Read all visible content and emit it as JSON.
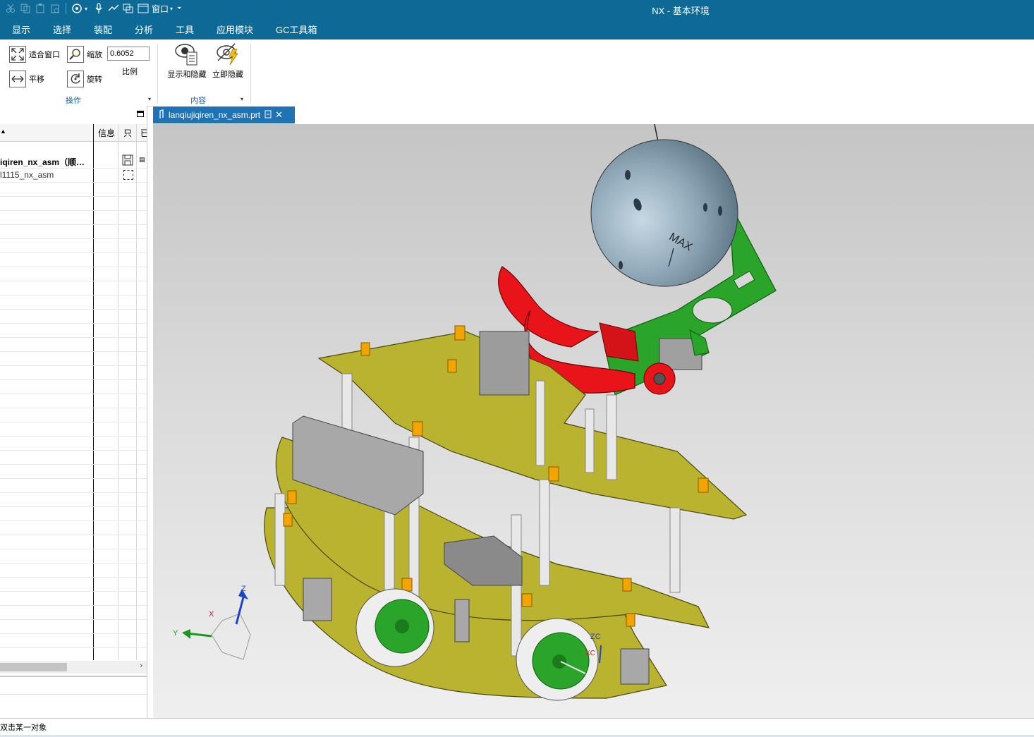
{
  "window": {
    "title": "NX - 基本环境"
  },
  "quick_access": {
    "window_menu_label": "窗口"
  },
  "menu": {
    "items": [
      "显示",
      "选择",
      "装配",
      "分析",
      "工具",
      "应用模块",
      "GC工具箱"
    ]
  },
  "ribbon": {
    "fit_window": "适合窗口",
    "zoom": "缩放",
    "scale_value": "0.6052",
    "scale_label": "比例",
    "pan": "平移",
    "rotate": "旋转",
    "group_ops": "操作",
    "show_hide": "显示和隐藏",
    "hide_now": "立即隐藏",
    "group_content": "内容"
  },
  "navigator": {
    "columns": [
      "信息",
      "只",
      "已"
    ],
    "rows": [
      {
        "name": "iqiren_nx_asm（顺…",
        "bold": true
      },
      {
        "name": "l1115_nx_asm",
        "bold": false
      }
    ]
  },
  "tab": {
    "filename": "lanqiujiqiren_nx_asm.prt"
  },
  "model": {
    "ball_text": "MAX",
    "axis_labels": {
      "z": "Z",
      "x": "X",
      "y": "Y",
      "zc": "ZC",
      "xc": "XC"
    }
  },
  "status": {
    "text": "双击某一对象"
  },
  "colors": {
    "title_bg": "#0d6a96",
    "tab_active": "#1f73b5",
    "plate": "#b9b330",
    "claw": "#e8141a",
    "bracket": "#28a428",
    "ball": "#8fa6b5"
  }
}
